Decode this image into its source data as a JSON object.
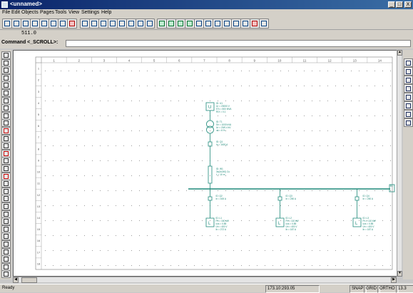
{
  "window": {
    "title": "<unnamed>"
  },
  "menu": [
    "File",
    "Edit",
    "Objects",
    "Pages",
    "Tools",
    "View",
    "Settings",
    "Help"
  ],
  "window_controls": {
    "minimize": "_",
    "maximize": "□",
    "close": "X"
  },
  "coordinate": "511.0",
  "command": {
    "label": "Command <_SCROLL>:",
    "value": ""
  },
  "ruler": {
    "columns": [
      "1",
      "2",
      "3",
      "4",
      "5",
      "6",
      "7",
      "8",
      "9",
      "10",
      "11",
      "12",
      "13",
      "14"
    ],
    "rows": [
      "1",
      "2",
      "3",
      "4",
      "5",
      "6",
      "7",
      "8",
      "9",
      "10",
      "11",
      "12",
      "13",
      "14",
      "15",
      "16",
      "17",
      "18"
    ]
  },
  "status": {
    "ready": "Ready",
    "coords": "173.10:293.05",
    "modes": [
      "SNAP",
      "GRID",
      "ORTHO",
      "13.3"
    ]
  },
  "icons": {
    "toolbar": [
      "new-icon",
      "open-icon",
      "save-icon",
      "print-icon",
      "cut-icon",
      "copy-icon",
      "paste-icon",
      "undo-icon",
      "zoom-in-icon",
      "zoom-out-icon",
      "zoom-window-icon",
      "zoom-all-icon",
      "pan-icon",
      "redraw-icon",
      "layers-icon",
      "properties-icon",
      "grid-icon",
      "snap-icon",
      "ortho-icon",
      "measure-icon",
      "text-icon",
      "line-icon",
      "arc-icon",
      "circle-icon",
      "move-icon",
      "rotate-icon",
      "delete-icon",
      "check-icon"
    ],
    "left": [
      "select-icon",
      "point-icon",
      "busbar-icon",
      "source-icon",
      "transformer-icon",
      "breaker-icon",
      "switch-icon",
      "fuse-icon",
      "motor-icon",
      "load-icon",
      "cable-icon",
      "relay-icon",
      "meter-icon",
      "ground-icon",
      "capacitor-icon",
      "reactor-icon",
      "generator-icon",
      "battery-icon",
      "label-icon",
      "connector-icon",
      "node-icon",
      "bus-tie-icon",
      "feeder-icon",
      "panel-icon",
      "inverter-icon",
      "ups-icon",
      "filter-icon",
      "report-icon",
      "table-icon",
      "info-icon"
    ],
    "right": [
      "zoom-icon",
      "fit-icon",
      "mirror-icon",
      "align-icon",
      "copy-icon",
      "array-icon",
      "snap-point-icon",
      "bar-chart-icon"
    ]
  },
  "schematic_labels": {
    "source": [
      "ID: U1",
      "Ur = 20000 V",
      "S\"k = 500 MVA",
      "R/X = 0.1"
    ],
    "transformer": [
      "ID: T1",
      "Sn = 1000 kVA",
      "Ur = 20/0.4 kV",
      "uk = 6 %"
    ],
    "main_breaker": [
      "ID: Q1",
      "In = 1600 A"
    ],
    "main_cable": [
      "ID: W1",
      "3x(4x240) Cu",
      "L = 10 m"
    ],
    "feeders": [
      {
        "breaker": [
          "ID: Q2",
          "In = 400 A"
        ],
        "load": [
          "ID: L1",
          "Pn = 160 kW",
          "cos = 0.85",
          "Un = 400 V",
          "Ib = 272 A"
        ]
      },
      {
        "breaker": [
          "ID: Q3",
          "In = 250 A"
        ],
        "load": [
          "ID: L2",
          "Pn = 110 kW",
          "cos = 0.85",
          "Un = 400 V",
          "Ib = 187 A"
        ]
      },
      {
        "breaker": [
          "ID: Q4",
          "In = 250 A"
        ],
        "load": [
          "ID: L3",
          "Pn = 110 kW",
          "cos = 0.85",
          "Un = 400 V",
          "Ib = 187 A"
        ]
      }
    ],
    "busbar": "B1"
  },
  "colors": {
    "schematic": "#1f8a7a",
    "grid": "#9a9a9a",
    "titlebar": "#0a246a"
  }
}
